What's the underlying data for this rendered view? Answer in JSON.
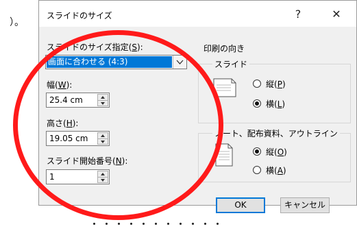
{
  "background": {
    "corner_text": "）。",
    "bottom_text": "・・・・・・・・・・・"
  },
  "dialog": {
    "title": "スライドのサイズ",
    "help_button": "?",
    "close_button": "✕",
    "slide_size": {
      "label_prefix": "スライドのサイズ指定(",
      "label_key": "S",
      "label_suffix": "):",
      "selected": "画面に合わせる (4:3)"
    },
    "width": {
      "label_prefix": "幅(",
      "label_key": "W",
      "label_suffix": "):",
      "value": "25.4 cm"
    },
    "height": {
      "label_prefix": "高さ(",
      "label_key": "H",
      "label_suffix": "):",
      "value": "19.05 cm"
    },
    "start_number": {
      "label_prefix": "スライド開始番号(",
      "label_key": "N",
      "label_suffix": "):",
      "value": "1"
    },
    "orientation": {
      "title": "印刷の向き",
      "slide": {
        "title": "スライド",
        "portrait_prefix": "縦(",
        "portrait_key": "P",
        "portrait_suffix": ")",
        "landscape_prefix": "横(",
        "landscape_key": "L",
        "landscape_suffix": ")",
        "selected": "landscape"
      },
      "notes": {
        "title": "ノート、配布資料、アウトライン",
        "portrait_prefix": "縦(",
        "portrait_key": "O",
        "portrait_suffix": ")",
        "landscape_prefix": "横(",
        "landscape_key": "A",
        "landscape_suffix": ")",
        "selected": "portrait"
      }
    },
    "ok_button": "OK",
    "cancel_button": "キャンセル"
  },
  "colors": {
    "annotation": "#ff1a1a",
    "selection": "#0078d7"
  },
  "icons": [
    "page-landscape-icon",
    "page-portrait-icon",
    "dropdown-arrow-icon",
    "spin-up-icon",
    "spin-down-icon"
  ]
}
